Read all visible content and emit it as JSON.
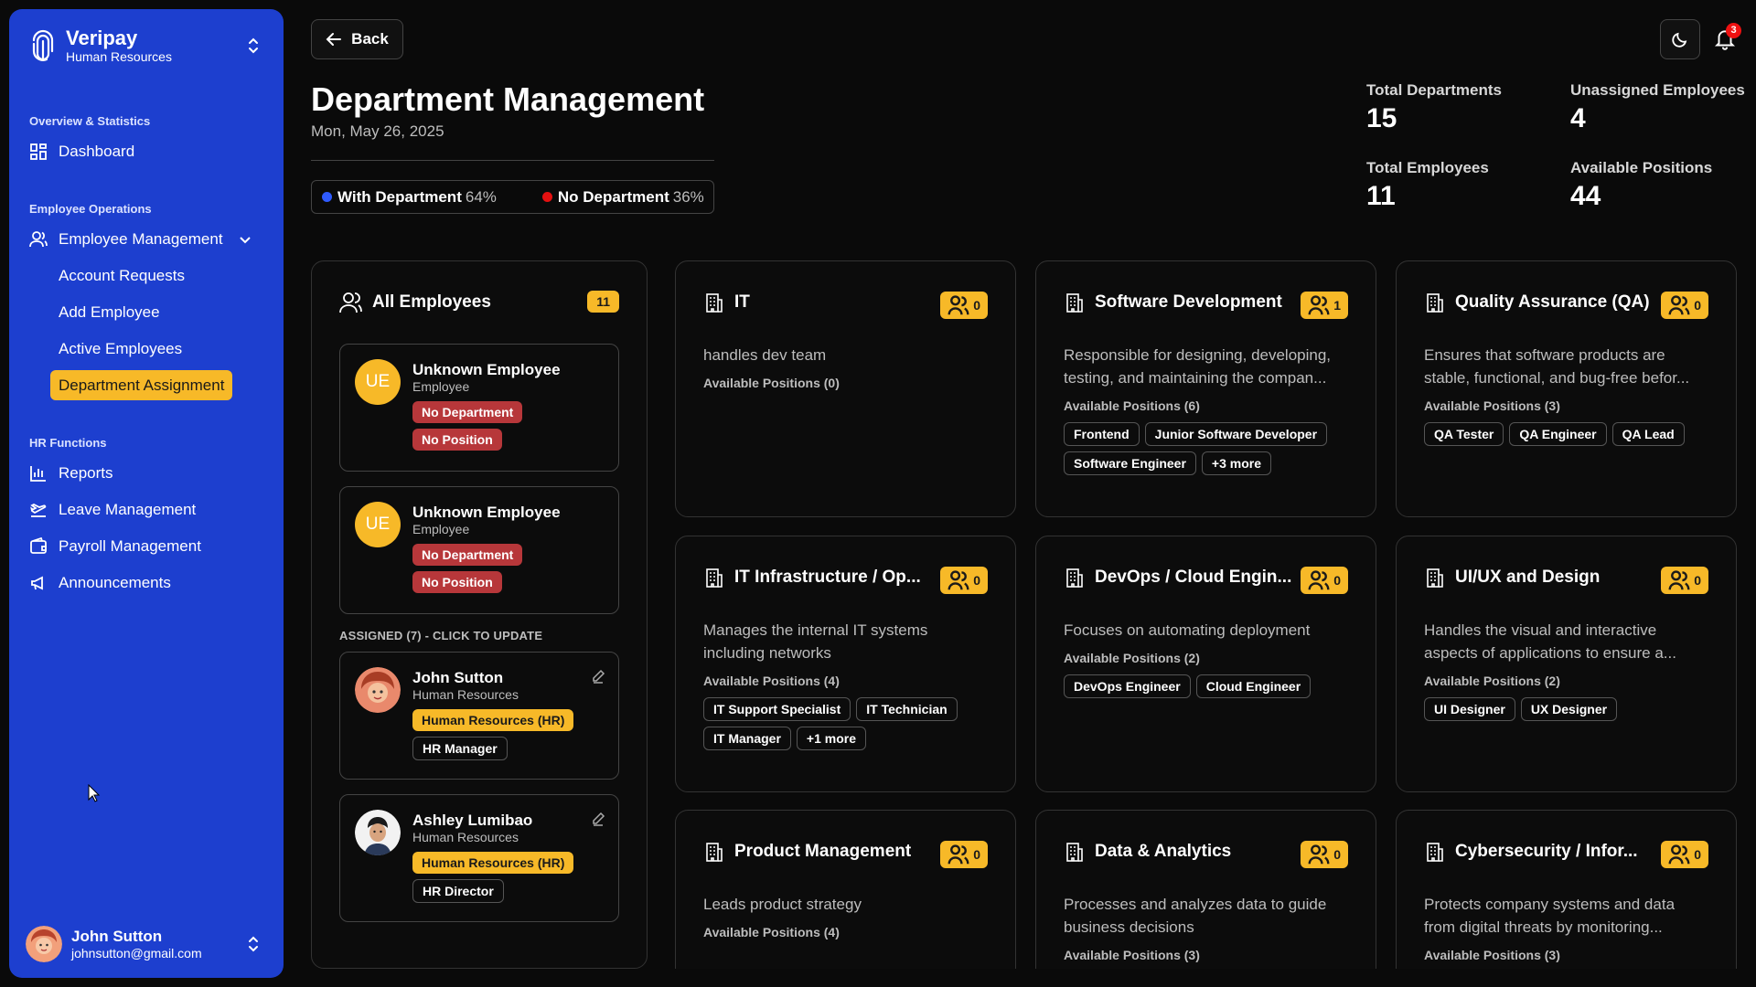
{
  "sidebar": {
    "brand": "Veripay",
    "brand_sub": "Human Resources",
    "sections": [
      {
        "title": "Overview & Statistics",
        "items": [
          {
            "label": "Dashboard"
          }
        ]
      },
      {
        "title": "Employee Operations",
        "items": [
          {
            "label": "Employee Management"
          }
        ],
        "subitems": [
          "Account Requests",
          "Add Employee",
          "Active Employees",
          "Department Assignment"
        ]
      },
      {
        "title": "HR Functions",
        "items": [
          {
            "label": "Reports"
          },
          {
            "label": "Leave Management"
          },
          {
            "label": "Payroll Management"
          },
          {
            "label": "Announcements"
          }
        ]
      }
    ],
    "user": {
      "name": "John Sutton",
      "email": "johnsutton@gmail.com"
    }
  },
  "header": {
    "back_label": "Back",
    "title": "Department Management",
    "date": "Mon, May 26, 2025",
    "legend": [
      {
        "label": "With Department",
        "pct": "64%",
        "color": "#2f5bff"
      },
      {
        "label": "No Department",
        "pct": "36%",
        "color": "#e41010"
      }
    ],
    "notification_count": "3",
    "stats": [
      {
        "label": "Total Departments",
        "value": "15"
      },
      {
        "label": "Unassigned Employees",
        "value": "4"
      },
      {
        "label": "Total Employees",
        "value": "11"
      },
      {
        "label": "Available Positions",
        "value": "44"
      }
    ]
  },
  "employees": {
    "title": "All Employees",
    "count": "11",
    "unassigned": [
      {
        "initials": "UE",
        "name": "Unknown Employee",
        "role": "Employee",
        "dept": "No Department",
        "position": "No Position"
      },
      {
        "initials": "UE",
        "name": "Unknown Employee",
        "role": "Employee",
        "dept": "No Department",
        "position": "No Position"
      }
    ],
    "assigned_label": "ASSIGNED (7) - CLICK TO UPDATE",
    "assigned": [
      {
        "name": "John Sutton",
        "role": "Human Resources",
        "dept": "Human Resources (HR)",
        "position": "HR Manager"
      },
      {
        "name": "Ashley Lumibao",
        "role": "Human Resources",
        "dept": "Human Resources (HR)",
        "position": "HR Director"
      }
    ]
  },
  "departments": [
    {
      "name": "IT",
      "count": "0",
      "desc": "handles dev team",
      "positions_label": "Available Positions (0)",
      "positions": []
    },
    {
      "name": "Software Development",
      "count": "1",
      "desc": "Responsible for designing, developing, testing, and maintaining the compan...",
      "positions_label": "Available Positions (6)",
      "positions": [
        "Frontend",
        "Junior Software Developer",
        "Software Engineer",
        "+3 more"
      ]
    },
    {
      "name": "Quality Assurance (QA)",
      "count": "0",
      "desc": "Ensures that software products are stable, functional, and bug-free befor...",
      "positions_label": "Available Positions (3)",
      "positions": [
        "QA Tester",
        "QA Engineer",
        "QA Lead"
      ]
    },
    {
      "name": "IT Infrastructure / Op...",
      "count": "0",
      "desc": "Manages the internal IT systems including networks",
      "positions_label": "Available Positions (4)",
      "positions": [
        "IT Support Specialist",
        "IT Technician",
        "IT Manager",
        "+1 more"
      ]
    },
    {
      "name": "DevOps / Cloud Engin...",
      "count": "0",
      "desc": "Focuses on automating deployment",
      "positions_label": "Available Positions (2)",
      "positions": [
        "DevOps Engineer",
        "Cloud Engineer"
      ]
    },
    {
      "name": "UI/UX and Design",
      "count": "0",
      "desc": "Handles the visual and interactive aspects of applications to ensure a...",
      "positions_label": "Available Positions (2)",
      "positions": [
        "UI Designer",
        "UX Designer"
      ]
    },
    {
      "name": "Product Management",
      "count": "0",
      "desc": "Leads product strategy",
      "positions_label": "Available Positions (4)",
      "positions": []
    },
    {
      "name": "Data & Analytics",
      "count": "0",
      "desc": "Processes and analyzes data to guide business decisions",
      "positions_label": "Available Positions (3)",
      "positions": []
    },
    {
      "name": "Cybersecurity / Infor...",
      "count": "0",
      "desc": "Protects company systems and data from digital threats by monitoring...",
      "positions_label": "Available Positions (3)",
      "positions": []
    }
  ]
}
